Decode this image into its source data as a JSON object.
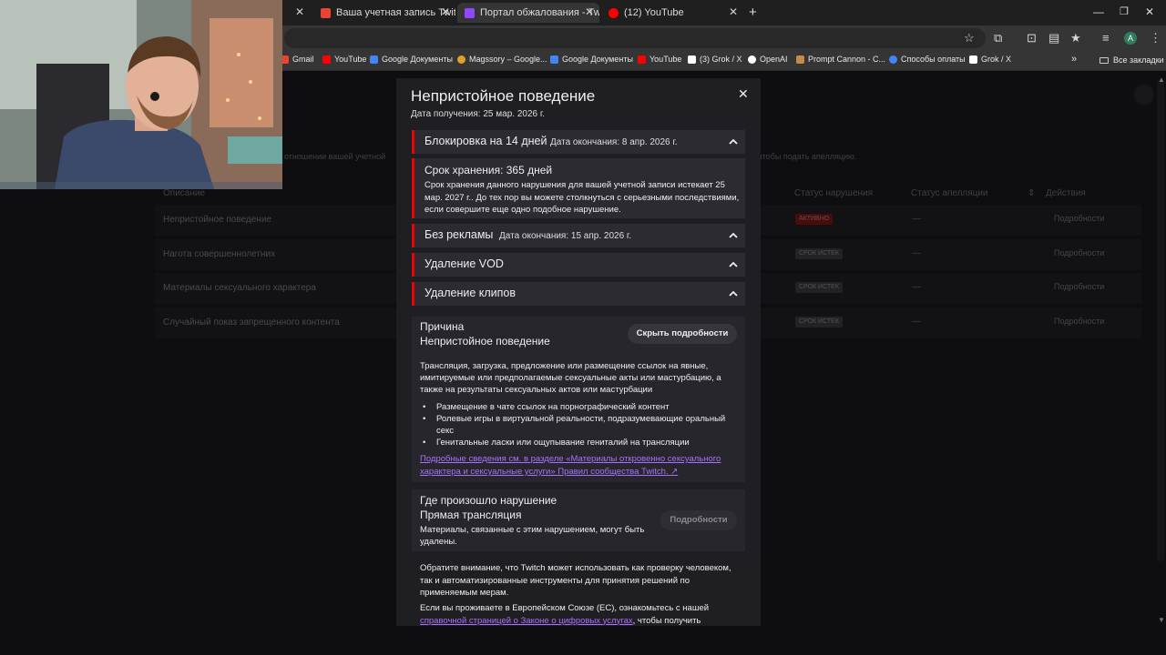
{
  "browser": {
    "tabs": [
      {
        "title": "Ваша учетная запись Twitch A",
        "favicon_color": "#ea4335"
      },
      {
        "title": "Портал обжалования - Twitch",
        "favicon_color": "#9146ff"
      },
      {
        "title": "(12) YouTube",
        "favicon_color": "#ff0000"
      }
    ],
    "bookmarks": [
      {
        "label": "Gmail",
        "icon_color": "#ea4335"
      },
      {
        "label": "YouTube",
        "icon_color": "#ff0000"
      },
      {
        "label": "Google Документы",
        "icon_color": "#4285f4"
      },
      {
        "label": "Magssory – Google...",
        "icon_color": "#e0a02a"
      },
      {
        "label": "Google Документы",
        "icon_color": "#4285f4"
      },
      {
        "label": "YouTube",
        "icon_color": "#ff0000"
      },
      {
        "label": "(3) Grok / X",
        "icon_color": "#ffffff"
      },
      {
        "label": "OpenAI",
        "icon_color": "#ffffff"
      },
      {
        "label": "Prompt Cannon - C...",
        "icon_color": "#c58b4a"
      },
      {
        "label": "Способы оплаты",
        "icon_color": "#4285f4"
      },
      {
        "label": "Grok / X",
        "icon_color": "#ffffff"
      }
    ],
    "all_bookmarks": "Все закладки",
    "profile_initial": "A"
  },
  "background_page": {
    "intro_text": "отношении вашей учетной",
    "intro_text_right": "чтобы подать апелляцию.",
    "headers": {
      "description": "Описание",
      "violation_status": "Статус нарушения",
      "appeal_status": "Статус апелляции",
      "actions": "Действия"
    },
    "rows": [
      {
        "description": "Непристойное поведение",
        "status": "АКТИВНО",
        "appeal": "—",
        "action": "Подробности"
      },
      {
        "description": "Нагота совершеннолетних",
        "status": "СРОК ИСТЕК",
        "appeal": "—",
        "action": "Подробности"
      },
      {
        "description": "Материалы сексуального характера",
        "status": "СРОК ИСТЕК",
        "appeal": "—",
        "action": "Подробности"
      },
      {
        "description": "Случайный показ запрещенного контента",
        "status": "СРОК ИСТЕК",
        "appeal": "—",
        "action": "Подробности"
      }
    ]
  },
  "modal": {
    "title": "Непристойное поведение",
    "received_date": "Дата получения: 25 мар. 2026 г.",
    "penalties": [
      {
        "title": "Блокировка на 14 дней",
        "end_date": "Дата окончания: 8 апр. 2026 г."
      },
      {
        "title": "Без рекламы",
        "end_date": "Дата окончания: 15 апр. 2026 г."
      },
      {
        "title": "Удаление VOD",
        "end_date": ""
      },
      {
        "title": "Удаление клипов",
        "end_date": ""
      }
    ],
    "retention": {
      "title": "Срок хранения: 365 дней",
      "body": "Срок хранения данного нарушения для вашей учетной записи истекает 25 мар. 2027 г.. До тех пор вы можете столкнуться с серьезными последствиями, если совершите еще одно подобное нарушение."
    },
    "reason": {
      "label": "Причина",
      "value": "Непристойное поведение",
      "hide_button": "Скрыть подробности",
      "description": "Трансляция, загрузка, предложение или размещение ссылок на явные, имитируемые или предполагаемые сексуальные акты или мастурбацию, а также на результаты сексуальных актов или мастурбации",
      "bullets": [
        "Размещение в чате ссылок на порнографический контент",
        "Ролевые игры в виртуальной реальности, подразумевающие оральный секс",
        "Генитальные ласки или ощупывание гениталий на трансляции"
      ],
      "link": "Подробные сведения см. в разделе «Материалы откровенно сексуального характера и сексуальные услуги» Правил сообщества Twitch."
    },
    "location": {
      "label": "Где произошло нарушение",
      "value": "Прямая трансляция",
      "description": "Материалы, связанные с этим нарушением, могут быть удалены.",
      "details_button": "Подробности"
    },
    "notice": "Обратите внимание, что Twitch может использовать как проверку человеком, так и автоматизированные инструменты для принятия решений по применяемым мерам.",
    "eu_prefix": "Если вы проживаете в Европейском Союзе (ЕС), ознакомьтесь с нашей",
    "eu_link": "справочной страницей о Законе о цифровых услугах",
    "eu_suffix": ", чтобы получить"
  }
}
